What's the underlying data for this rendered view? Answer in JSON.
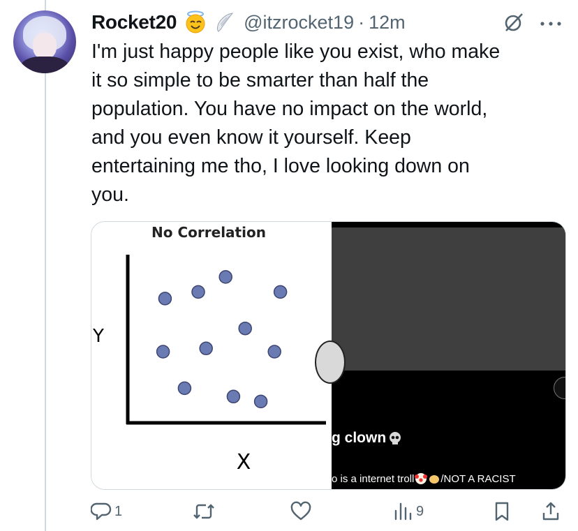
{
  "author": {
    "name": "Rocket20",
    "handle": "@itzrocket19",
    "separator": "·",
    "time": "12m"
  },
  "tweet": {
    "text": "I'm just happy people like you exist, who make\nit so simple to be smarter than half the\npopulation. You have no impact on the world,\nand you even know it yourself. Keep\nentertaining me tho, I love looking down on\nyou."
  },
  "media": {
    "left": {
      "chart_data": {
        "type": "scatter",
        "title": "No Correlation",
        "xlabel": "X",
        "ylabel": "Y",
        "grid": false,
        "xlim": [
          0,
          100
        ],
        "ylim": [
          0,
          100
        ],
        "points": [
          {
            "x": 18,
            "y": 74
          },
          {
            "x": 35,
            "y": 78
          },
          {
            "x": 49,
            "y": 87
          },
          {
            "x": 77,
            "y": 78
          },
          {
            "x": 59,
            "y": 56
          },
          {
            "x": 17,
            "y": 42
          },
          {
            "x": 39,
            "y": 44
          },
          {
            "x": 74,
            "y": 42
          },
          {
            "x": 28,
            "y": 20
          },
          {
            "x": 53,
            "y": 15
          },
          {
            "x": 67,
            "y": 12
          }
        ],
        "point_color": "#6a7bb4"
      }
    },
    "right": {
      "title": "g clown",
      "bio": "o is a internet troll",
      "bio_suffix": "/NOT A RACIST"
    }
  },
  "actions": {
    "replies": "1",
    "views": "9"
  },
  "colors": {
    "muted": "#536471",
    "text": "#0f1419",
    "border": "#cfd9de"
  }
}
